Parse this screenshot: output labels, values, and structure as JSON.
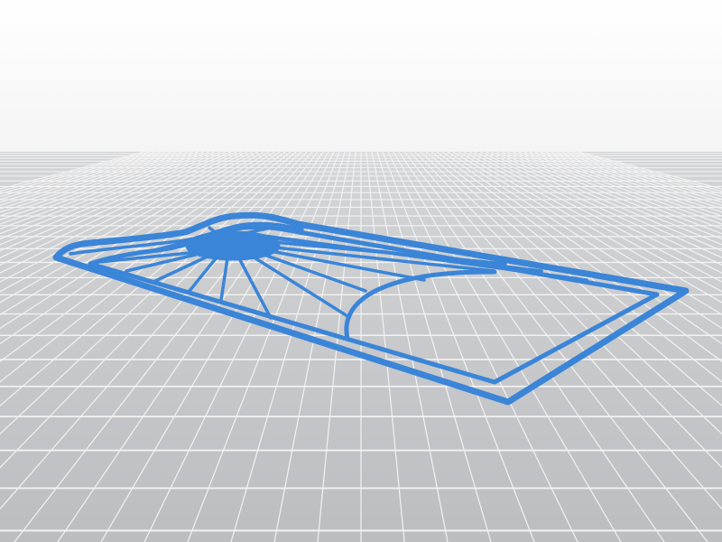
{
  "scene": {
    "subject": "3d-printed-stencil-model-preview",
    "colors": {
      "sky_top": "#ffffff",
      "sky_bottom": "#d9d9d9",
      "floor": "#c6c7c9",
      "grid_line": "#f2f2f2",
      "model": "#3a85d8",
      "model_edge": "#2c6fbf"
    }
  }
}
